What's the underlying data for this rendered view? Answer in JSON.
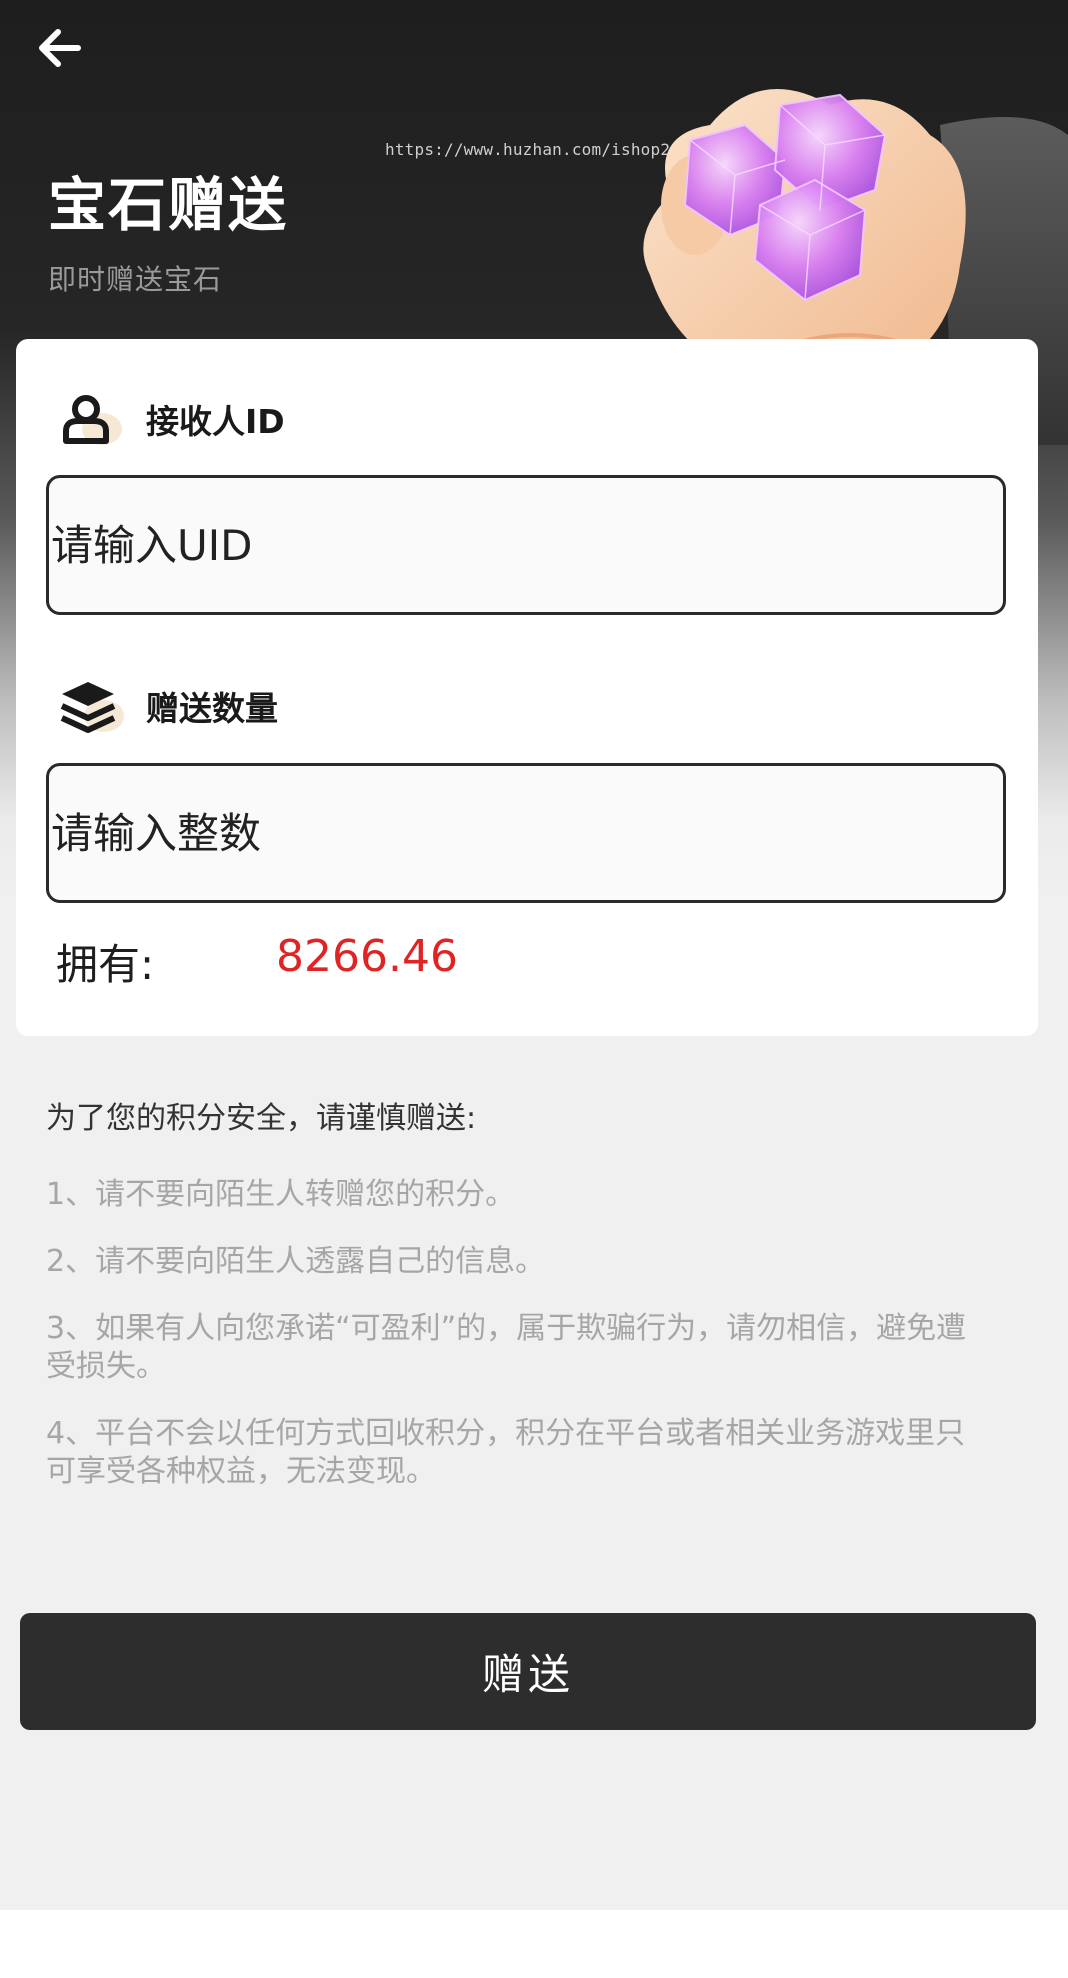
{
  "header": {
    "title": "宝石赠送",
    "subtitle": "即时赠送宝石",
    "watermark": "https://www.huzhan.com/ishop26228"
  },
  "form": {
    "receiver": {
      "label": "接收人ID",
      "placeholder": "请输入UID",
      "value": ""
    },
    "amount": {
      "label": "赠送数量",
      "placeholder": "请输入整数",
      "value": ""
    },
    "balance": {
      "label": "拥有:",
      "value": "8266.46"
    }
  },
  "notice": {
    "title": "为了您的积分安全，请谨慎赠送:",
    "items": [
      "1、请不要向陌生人转赠您的积分。",
      "2、请不要向陌生人透露自己的信息。",
      "3、如果有人向您承诺“可盈利”的，属于欺骗行为，请勿相信，避免遭受损失。",
      "4、平台不会以任何方式回收积分，积分在平台或者相关业务游戏里只可享受各种权益，无法变现。"
    ]
  },
  "actions": {
    "submit_label": "赠送"
  },
  "icons": {
    "back": "back-arrow-icon",
    "receiver": "user-icon",
    "amount": "layers-icon",
    "hero": "hand-holding-gems-icon"
  },
  "colors": {
    "header_bg": "#1e1e1e",
    "balance_value": "#e02424",
    "button_bg": "#2d2d2d",
    "gem": "#d77cf2"
  }
}
